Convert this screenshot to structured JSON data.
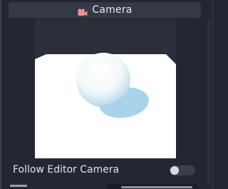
{
  "panel": {
    "title": "Camera",
    "title_icon": "camera-icon",
    "accent_color": "#f08f8f"
  },
  "settings": {
    "follow_editor_camera": {
      "label": "Follow Editor Camera",
      "enabled": false
    }
  }
}
